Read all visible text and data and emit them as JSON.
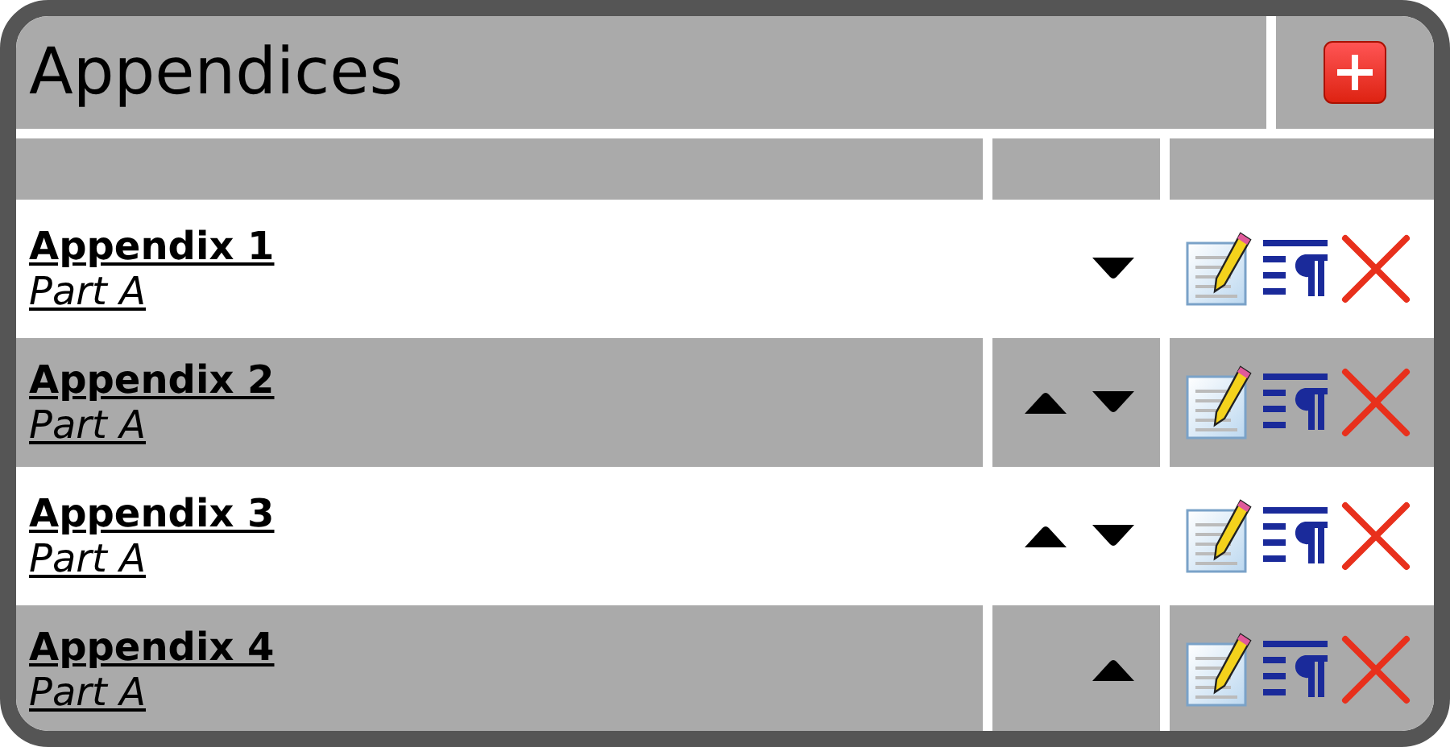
{
  "title": "Appendices",
  "rows": [
    {
      "name": "Appendix 1",
      "part": "Part A",
      "can_move_up": false,
      "can_move_down": true
    },
    {
      "name": "Appendix 2",
      "part": "Part A",
      "can_move_up": true,
      "can_move_down": true
    },
    {
      "name": "Appendix 3",
      "part": "Part A",
      "can_move_up": true,
      "can_move_down": true
    },
    {
      "name": "Appendix 4",
      "part": "Part A",
      "can_move_up": true,
      "can_move_down": false
    }
  ]
}
